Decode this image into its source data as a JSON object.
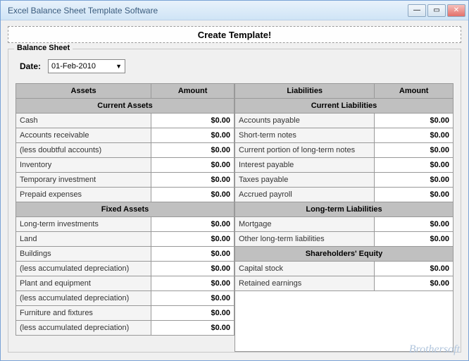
{
  "window": {
    "title": "Excel Balance Sheet Template Software"
  },
  "buttons": {
    "create": "Create Template!"
  },
  "fieldset": {
    "legend": "Balance Sheet"
  },
  "date": {
    "label": "Date:",
    "value": "01-Feb-2010"
  },
  "headers": {
    "assets": "Assets",
    "amount": "Amount",
    "liabilities": "Liabilities"
  },
  "subheaders": {
    "current_assets": "Current Assets",
    "fixed_assets": "Fixed Assets",
    "current_liabilities": "Current Liabilities",
    "long_term_liabilities": "Long-term Liabilities",
    "shareholders_equity": "Shareholders' Equity"
  },
  "assets": {
    "current": [
      {
        "label": "Cash",
        "amount": "$0.00"
      },
      {
        "label": "Accounts receivable",
        "amount": "$0.00"
      },
      {
        "label": "(less doubtful accounts)",
        "amount": "$0.00"
      },
      {
        "label": "Inventory",
        "amount": "$0.00"
      },
      {
        "label": "Temporary investment",
        "amount": "$0.00"
      },
      {
        "label": "Prepaid expenses",
        "amount": "$0.00"
      }
    ],
    "fixed": [
      {
        "label": "Long-term investments",
        "amount": "$0.00"
      },
      {
        "label": "Land",
        "amount": "$0.00"
      },
      {
        "label": "Buildings",
        "amount": "$0.00"
      },
      {
        "label": "(less accumulated depreciation)",
        "amount": "$0.00"
      },
      {
        "label": "Plant and equipment",
        "amount": "$0.00"
      },
      {
        "label": "(less accumulated depreciation)",
        "amount": "$0.00"
      },
      {
        "label": "Furniture and fixtures",
        "amount": "$0.00"
      },
      {
        "label": "(less accumulated depreciation)",
        "amount": "$0.00"
      }
    ]
  },
  "liabilities": {
    "current": [
      {
        "label": "Accounts payable",
        "amount": "$0.00"
      },
      {
        "label": "Short-term notes",
        "amount": "$0.00"
      },
      {
        "label": "Current portion of long-term notes",
        "amount": "$0.00"
      },
      {
        "label": "Interest payable",
        "amount": "$0.00"
      },
      {
        "label": "Taxes payable",
        "amount": "$0.00"
      },
      {
        "label": "Accrued payroll",
        "amount": "$0.00"
      }
    ],
    "long_term": [
      {
        "label": "Mortgage",
        "amount": "$0.00"
      },
      {
        "label": "Other long-term liabilities",
        "amount": "$0.00"
      }
    ],
    "equity": [
      {
        "label": "Capital stock",
        "amount": "$0.00"
      },
      {
        "label": "Retained earnings",
        "amount": "$0.00"
      }
    ]
  },
  "watermark": "Brothersoft"
}
